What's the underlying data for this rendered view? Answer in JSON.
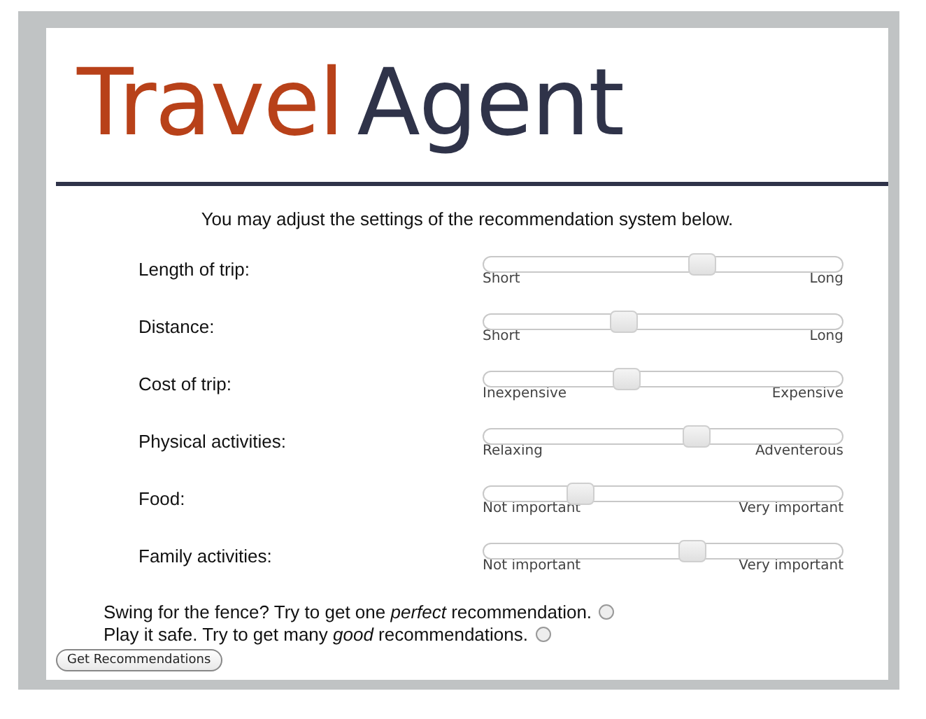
{
  "logo": {
    "first": "Travel",
    "second": "Agent"
  },
  "intro": "You may adjust the settings of the recommendation system below.",
  "settings": [
    {
      "label": "Length of trip:",
      "min_label": "Short",
      "max_label": "Long",
      "level": 0.62
    },
    {
      "label": "Distance:",
      "min_label": "Short",
      "max_label": "Long",
      "level": 0.38
    },
    {
      "label": "Cost of trip:",
      "min_label": "Inexpensive",
      "max_label": "Expensive",
      "level": 0.39
    },
    {
      "label": "Physical activities:",
      "min_label": "Relaxing",
      "max_label": "Adventerous",
      "level": 0.6
    },
    {
      "label": "Food:",
      "min_label": "Not important",
      "max_label": "Very important",
      "level": 0.25
    },
    {
      "label": "Family activities:",
      "min_label": "Not important",
      "max_label": "Very important",
      "level": 0.59
    }
  ],
  "strategies": [
    {
      "text": "Swing for the fence? Try to get one *perfect* recommendation.",
      "selected": false
    },
    {
      "text": "Play it safe. Try to get many *good* recommendations.",
      "selected": false
    }
  ],
  "button": "Get Recommendations"
}
